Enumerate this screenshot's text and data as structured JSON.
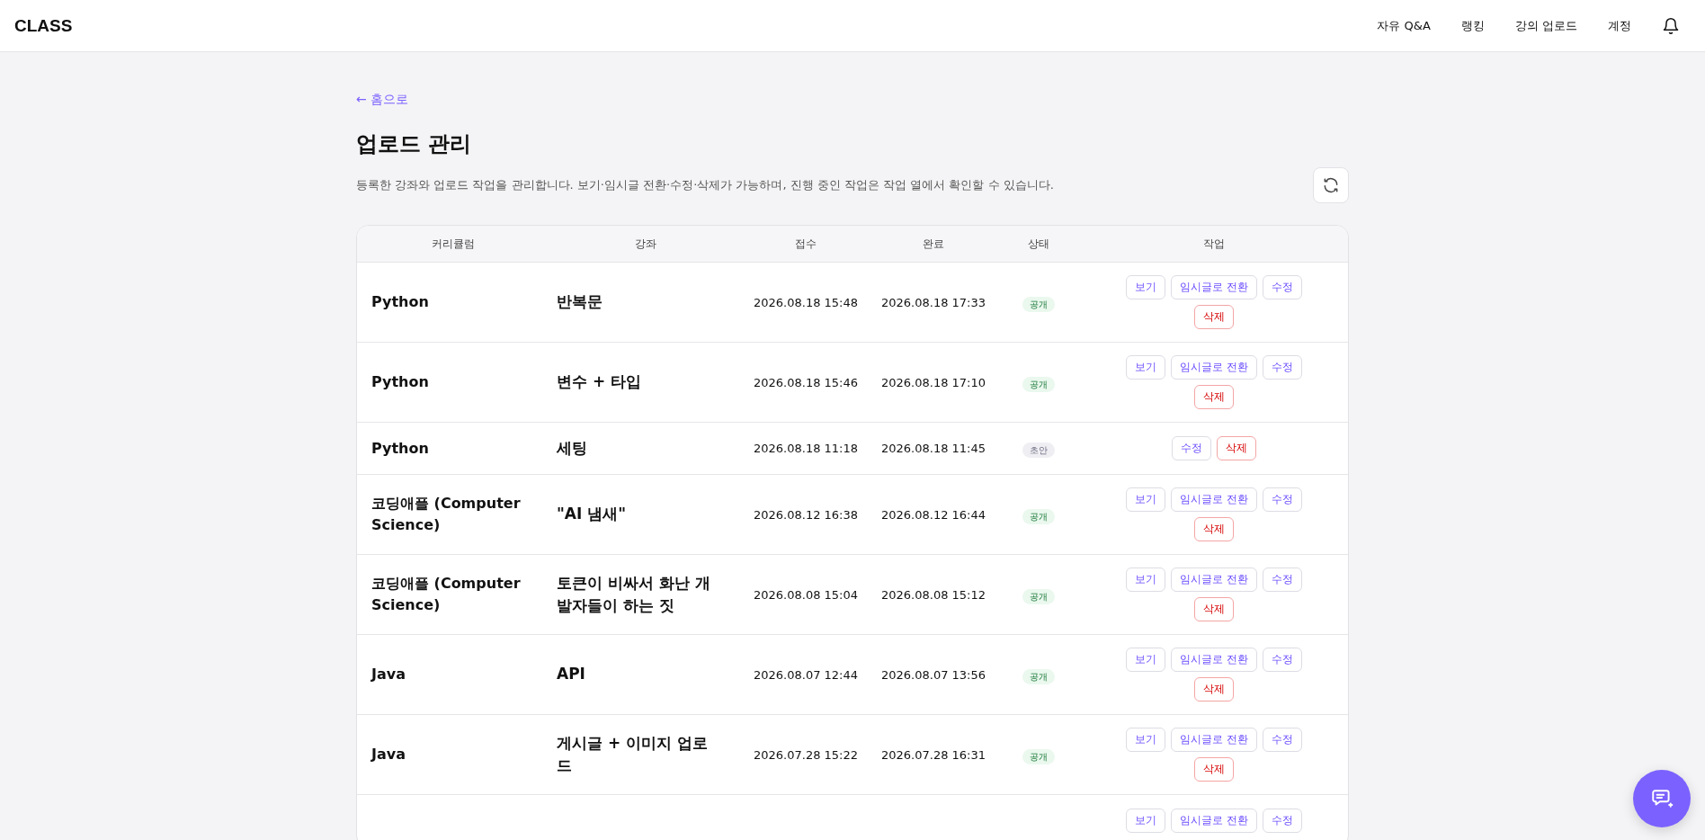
{
  "header": {
    "logo": "CLASS",
    "nav": [
      "자유 Q&A",
      "랭킹",
      "강의 업로드",
      "계정"
    ]
  },
  "back_link": "← 홈으로",
  "title": "업로드 관리",
  "description": "등록한 강좌와 업로드 작업을 관리합니다. 보기·임시글 전환·수정·삭제가 가능하며, 진행 중인 작업은 작업 열에서 확인할 수 있습니다.",
  "table": {
    "columns": [
      "커리큘럼",
      "강좌",
      "접수",
      "완료",
      "상태",
      "작업"
    ],
    "rows": [
      {
        "curriculum": "Python",
        "course": "반복문",
        "received": "2026.08.18 15:48",
        "completed": "2026.08.18 17:33",
        "status": {
          "label": "공개",
          "kind": "public"
        },
        "actions": [
          {
            "label": "보기",
            "kind": "normal"
          },
          {
            "label": "임시글로 전환",
            "kind": "normal"
          },
          {
            "label": "수정",
            "kind": "normal"
          },
          {
            "label": "삭제",
            "kind": "danger"
          }
        ]
      },
      {
        "curriculum": "Python",
        "course": "변수 + 타입",
        "received": "2026.08.18 15:46",
        "completed": "2026.08.18 17:10",
        "status": {
          "label": "공개",
          "kind": "public"
        },
        "actions": [
          {
            "label": "보기",
            "kind": "normal"
          },
          {
            "label": "임시글로 전환",
            "kind": "normal"
          },
          {
            "label": "수정",
            "kind": "normal"
          },
          {
            "label": "삭제",
            "kind": "danger"
          }
        ]
      },
      {
        "curriculum": "Python",
        "course": "세팅",
        "received": "2026.08.18 11:18",
        "completed": "2026.08.18 11:45",
        "status": {
          "label": "초안",
          "kind": "draft"
        },
        "actions": [
          {
            "label": "수정",
            "kind": "normal"
          },
          {
            "label": "삭제",
            "kind": "danger"
          }
        ]
      },
      {
        "curriculum": "코딩애플 (Computer Science)",
        "course": "\"AI 냄새\"",
        "received": "2026.08.12 16:38",
        "completed": "2026.08.12 16:44",
        "status": {
          "label": "공개",
          "kind": "public"
        },
        "actions": [
          {
            "label": "보기",
            "kind": "normal"
          },
          {
            "label": "임시글로 전환",
            "kind": "normal"
          },
          {
            "label": "수정",
            "kind": "normal"
          },
          {
            "label": "삭제",
            "kind": "danger"
          }
        ]
      },
      {
        "curriculum": "코딩애플 (Computer Science)",
        "course": "토큰이 비싸서 화난 개발자들이 하는 짓",
        "received": "2026.08.08 15:04",
        "completed": "2026.08.08 15:12",
        "status": {
          "label": "공개",
          "kind": "public"
        },
        "actions": [
          {
            "label": "보기",
            "kind": "normal"
          },
          {
            "label": "임시글로 전환",
            "kind": "normal"
          },
          {
            "label": "수정",
            "kind": "normal"
          },
          {
            "label": "삭제",
            "kind": "danger"
          }
        ]
      },
      {
        "curriculum": "Java",
        "course": "API",
        "received": "2026.08.07 12:44",
        "completed": "2026.08.07 13:56",
        "status": {
          "label": "공개",
          "kind": "public"
        },
        "actions": [
          {
            "label": "보기",
            "kind": "normal"
          },
          {
            "label": "임시글로 전환",
            "kind": "normal"
          },
          {
            "label": "수정",
            "kind": "normal"
          },
          {
            "label": "삭제",
            "kind": "danger"
          }
        ]
      },
      {
        "curriculum": "Java",
        "course": "게시글 + 이미지 업로드",
        "received": "2026.07.28 15:22",
        "completed": "2026.07.28 16:31",
        "status": {
          "label": "공개",
          "kind": "public"
        },
        "actions": [
          {
            "label": "보기",
            "kind": "normal"
          },
          {
            "label": "임시글로 전환",
            "kind": "normal"
          },
          {
            "label": "수정",
            "kind": "normal"
          },
          {
            "label": "삭제",
            "kind": "danger"
          }
        ]
      },
      {
        "actions": [
          {
            "label": "보기",
            "kind": "normal"
          },
          {
            "label": "임시글로 전환",
            "kind": "normal"
          },
          {
            "label": "수정",
            "kind": "normal"
          }
        ]
      }
    ]
  }
}
